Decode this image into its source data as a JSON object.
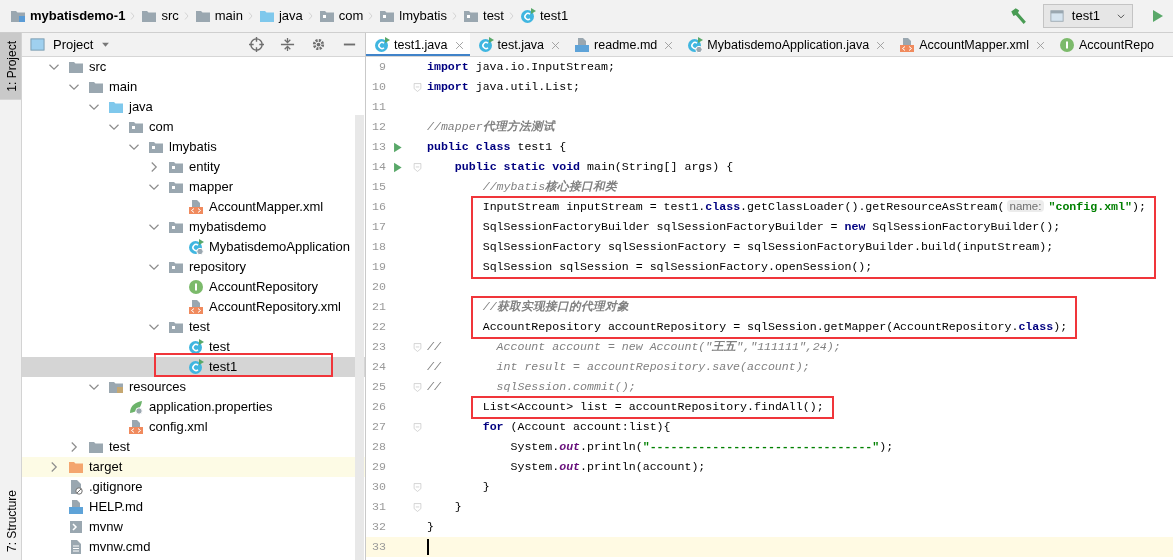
{
  "breadcrumbs": [
    {
      "label": "mybatisdemo-1",
      "kind": "module"
    },
    {
      "label": "src",
      "kind": "folder"
    },
    {
      "label": "main",
      "kind": "folder"
    },
    {
      "label": "java",
      "kind": "source-folder"
    },
    {
      "label": "com",
      "kind": "package"
    },
    {
      "label": "lmybatis",
      "kind": "package"
    },
    {
      "label": "test",
      "kind": "package"
    },
    {
      "label": "test1",
      "kind": "class-run"
    }
  ],
  "toolbar": {
    "run_config": "test1"
  },
  "side_tabs": [
    {
      "label": "1: Project",
      "selected": true
    },
    {
      "label": "7: Structure",
      "selected": false
    }
  ],
  "project_panel": {
    "title": "Project",
    "tree": [
      {
        "label": "src",
        "kind": "folder",
        "expanded": true,
        "selected": false,
        "boxed": false,
        "children": [
          {
            "label": "main",
            "kind": "folder",
            "expanded": true,
            "selected": false,
            "boxed": false,
            "children": [
              {
                "label": "java",
                "kind": "source-folder",
                "expanded": true,
                "selected": false,
                "boxed": false,
                "children": [
                  {
                    "label": "com",
                    "kind": "package",
                    "expanded": true,
                    "selected": false,
                    "boxed": false,
                    "children": [
                      {
                        "label": "lmybatis",
                        "kind": "package",
                        "expanded": true,
                        "selected": false,
                        "boxed": false,
                        "children": [
                          {
                            "label": "entity",
                            "kind": "package",
                            "expanded": false,
                            "selected": false,
                            "boxed": false
                          },
                          {
                            "label": "mapper",
                            "kind": "package",
                            "expanded": true,
                            "selected": false,
                            "boxed": false,
                            "children": [
                              {
                                "label": "AccountMapper.xml",
                                "kind": "xml",
                                "selected": false,
                                "boxed": false
                              }
                            ]
                          },
                          {
                            "label": "mybatisdemo",
                            "kind": "package",
                            "expanded": true,
                            "selected": false,
                            "boxed": false,
                            "children": [
                              {
                                "label": "MybatisdemoApplication",
                                "kind": "spring-class",
                                "selected": false,
                                "boxed": false
                              }
                            ]
                          },
                          {
                            "label": "repository",
                            "kind": "package",
                            "expanded": true,
                            "selected": false,
                            "boxed": false,
                            "children": [
                              {
                                "label": "AccountRepository",
                                "kind": "interface",
                                "selected": false,
                                "boxed": false
                              },
                              {
                                "label": "AccountRepository.xml",
                                "kind": "xml",
                                "selected": false,
                                "boxed": false
                              }
                            ]
                          },
                          {
                            "label": "test",
                            "kind": "package",
                            "expanded": true,
                            "selected": false,
                            "boxed": false,
                            "children": [
                              {
                                "label": "test",
                                "kind": "class-run",
                                "selected": false,
                                "boxed": false
                              },
                              {
                                "label": "test1",
                                "kind": "class-run",
                                "selected": true,
                                "boxed": true
                              }
                            ]
                          }
                        ]
                      }
                    ]
                  }
                ]
              },
              {
                "label": "resources",
                "kind": "resources-folder",
                "expanded": true,
                "selected": false,
                "boxed": false,
                "children": [
                  {
                    "label": "application.properties",
                    "kind": "properties",
                    "selected": false,
                    "boxed": false
                  },
                  {
                    "label": "config.xml",
                    "kind": "xml",
                    "selected": false,
                    "boxed": false
                  }
                ]
              }
            ]
          },
          {
            "label": "test",
            "kind": "folder",
            "expanded": false,
            "selected": false,
            "boxed": false
          }
        ]
      },
      {
        "label": "target",
        "kind": "excluded-folder",
        "expanded": false,
        "selected": false,
        "boxed": false
      },
      {
        "label": ".gitignore",
        "kind": "ignore-file",
        "selected": false,
        "boxed": false
      },
      {
        "label": "HELP.md",
        "kind": "markdown",
        "selected": false,
        "boxed": false
      },
      {
        "label": "mvnw",
        "kind": "script",
        "selected": false,
        "boxed": false
      },
      {
        "label": "mvnw.cmd",
        "kind": "text-file",
        "selected": false,
        "boxed": false
      }
    ]
  },
  "editor": {
    "tabs": [
      {
        "label": "test1.java",
        "kind": "class-run",
        "selected": true,
        "closable": true
      },
      {
        "label": "test.java",
        "kind": "class-run",
        "selected": false,
        "closable": true
      },
      {
        "label": "readme.md",
        "kind": "markdown",
        "selected": false,
        "closable": true
      },
      {
        "label": "MybatisdemoApplication.java",
        "kind": "spring-class",
        "selected": false,
        "closable": true
      },
      {
        "label": "AccountMapper.xml",
        "kind": "xml",
        "selected": false,
        "closable": true
      },
      {
        "label": "AccountRepo",
        "kind": "interface",
        "selected": false,
        "closable": false
      }
    ],
    "lines": [
      {
        "number": "9",
        "run": false,
        "fold": false,
        "current": false,
        "boxed": false,
        "segments": [
          {
            "kind": "keyword",
            "text": "import"
          },
          {
            "kind": "plain",
            "text": " java.io.InputStream;"
          }
        ]
      },
      {
        "number": "10",
        "run": false,
        "fold": true,
        "current": false,
        "boxed": false,
        "segments": [
          {
            "kind": "keyword",
            "text": "import"
          },
          {
            "kind": "plain",
            "text": " java.util.List;"
          }
        ]
      },
      {
        "number": "11",
        "run": false,
        "fold": false,
        "current": false,
        "boxed": false
      },
      {
        "number": "12",
        "run": false,
        "fold": false,
        "current": false,
        "boxed": false,
        "segments": [
          {
            "kind": "comment",
            "text": "//mapper**代理方法测试**"
          }
        ]
      },
      {
        "number": "13",
        "run": true,
        "fold": false,
        "current": false,
        "boxed": false,
        "segments": [
          {
            "kind": "keyword",
            "text": "public class"
          },
          {
            "kind": "plain",
            "text": " test1 {"
          }
        ]
      },
      {
        "number": "14",
        "run": true,
        "fold": true,
        "current": false,
        "boxed": false,
        "segments": [
          {
            "kind": "keyword",
            "text": "    public static void"
          },
          {
            "kind": "plain",
            "text": " main(String[] args) {"
          }
        ]
      },
      {
        "number": "15",
        "run": false,
        "fold": false,
        "current": false,
        "boxed": false,
        "segments": [
          {
            "kind": "comment",
            "text": "        //mybatis**核心接口和类**"
          }
        ]
      },
      {
        "number": "16",
        "run": false,
        "fold": false,
        "current": false,
        "boxed": true,
        "segments": [
          {
            "kind": "plain",
            "text": "        InputStream inputStream = test1."
          },
          {
            "kind": "keyword",
            "text": "class"
          },
          {
            "kind": "plain",
            "text": ".getClassLoader().getResourceAsStream("
          },
          {
            "kind": "hint",
            "text": "name:"
          },
          {
            "kind": "string",
            "text": "\"config.xml\""
          },
          {
            "kind": "plain",
            "text": ");"
          }
        ]
      },
      {
        "number": "17",
        "run": false,
        "fold": false,
        "current": false,
        "boxed": true,
        "segments": [
          {
            "kind": "plain",
            "text": "        SqlSessionFactoryBuilder sqlSessionFactoryBuilder = "
          },
          {
            "kind": "keyword",
            "text": "new"
          },
          {
            "kind": "plain",
            "text": " SqlSessionFactoryBuilder();"
          }
        ]
      },
      {
        "number": "18",
        "run": false,
        "fold": false,
        "current": false,
        "boxed": true,
        "segments": [
          {
            "kind": "plain",
            "text": "        SqlSessionFactory sqlSessionFactory = sqlSessionFactoryBuilder.build(inputStream);"
          }
        ]
      },
      {
        "number": "19",
        "run": false,
        "fold": false,
        "current": false,
        "boxed": true,
        "segments": [
          {
            "kind": "plain",
            "text": "        SqlSession sqlSession = sqlSessionFactory.openSession();"
          }
        ]
      },
      {
        "number": "20",
        "run": false,
        "fold": false,
        "current": false,
        "boxed": false
      },
      {
        "number": "21",
        "run": false,
        "fold": false,
        "current": false,
        "boxed": true,
        "segments": [
          {
            "kind": "comment",
            "text": "        //**获取实现接口的代理对象**"
          }
        ]
      },
      {
        "number": "22",
        "run": false,
        "fold": false,
        "current": false,
        "boxed": true,
        "segments": [
          {
            "kind": "plain",
            "text": "        AccountRepository accountRepository = sqlSession.getMapper(AccountRepository."
          },
          {
            "kind": "keyword",
            "text": "class"
          },
          {
            "kind": "plain",
            "text": ");"
          }
        ]
      },
      {
        "number": "23",
        "run": false,
        "fold": true,
        "current": false,
        "boxed": false,
        "segments": [
          {
            "kind": "comment",
            "text": "//        Account account = new Account(\"**王五**\",\"111111\",24);"
          }
        ]
      },
      {
        "number": "24",
        "run": false,
        "fold": false,
        "current": false,
        "boxed": false,
        "segments": [
          {
            "kind": "comment",
            "text": "//        int result = accountRepository.save(account);"
          }
        ]
      },
      {
        "number": "25",
        "run": false,
        "fold": true,
        "current": false,
        "boxed": false,
        "segments": [
          {
            "kind": "comment",
            "text": "//        sqlSession.commit();"
          }
        ]
      },
      {
        "number": "26",
        "run": false,
        "fold": false,
        "current": false,
        "boxed": true,
        "segments": [
          {
            "kind": "plain",
            "text": "        List<Account> list = accountRepository.findAll();"
          }
        ]
      },
      {
        "number": "27",
        "run": false,
        "fold": true,
        "current": false,
        "boxed": false,
        "segments": [
          {
            "kind": "keyword",
            "text": "        for"
          },
          {
            "kind": "plain",
            "text": " (Account account:list){"
          }
        ]
      },
      {
        "number": "28",
        "run": false,
        "fold": false,
        "current": false,
        "boxed": false,
        "segments": [
          {
            "kind": "plain",
            "text": "            System."
          },
          {
            "kind": "field",
            "text": "out"
          },
          {
            "kind": "plain",
            "text": ".println("
          },
          {
            "kind": "string",
            "text": "\"--------------------------------\""
          },
          {
            "kind": "plain",
            "text": ");"
          }
        ]
      },
      {
        "number": "29",
        "run": false,
        "fold": false,
        "current": false,
        "boxed": false,
        "segments": [
          {
            "kind": "plain",
            "text": "            System."
          },
          {
            "kind": "field",
            "text": "out"
          },
          {
            "kind": "plain",
            "text": ".println(account);"
          }
        ]
      },
      {
        "number": "30",
        "run": false,
        "fold": true,
        "current": false,
        "boxed": false,
        "segments": [
          {
            "kind": "plain",
            "text": "        }"
          }
        ]
      },
      {
        "number": "31",
        "run": false,
        "fold": true,
        "current": false,
        "boxed": false,
        "segments": [
          {
            "kind": "plain",
            "text": "    }"
          }
        ]
      },
      {
        "number": "32",
        "run": false,
        "fold": false,
        "current": false,
        "boxed": false,
        "segments": [
          {
            "kind": "plain",
            "text": "}"
          }
        ]
      },
      {
        "number": "33",
        "run": false,
        "fold": false,
        "current": true,
        "boxed": false
      }
    ]
  }
}
